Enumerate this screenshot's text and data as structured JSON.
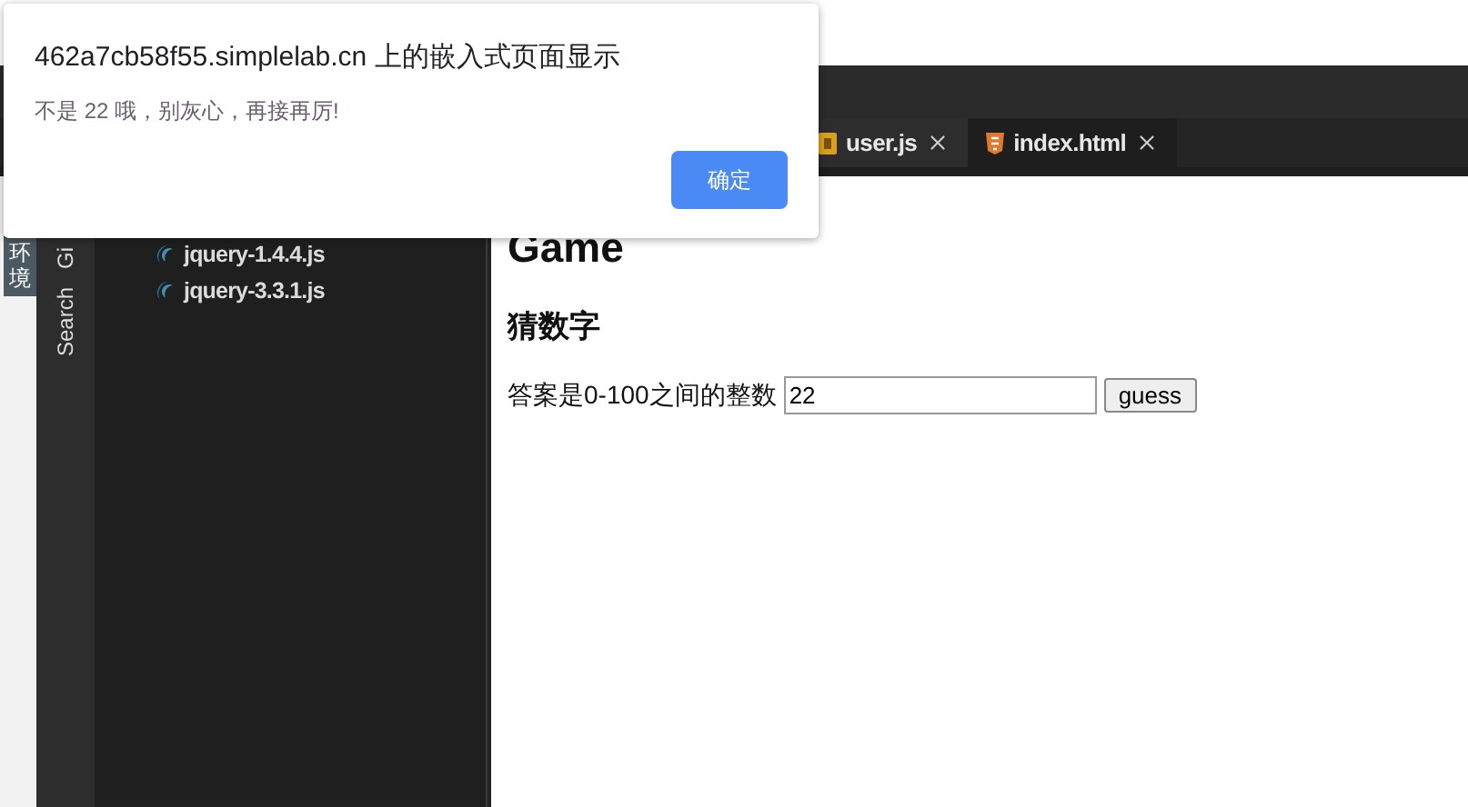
{
  "dialog": {
    "title": "462a7cb58f55.simplelab.cn 上的嵌入式页面显示",
    "message": "不是 22 哦，别灰心，再接再厉!",
    "button": "确定"
  },
  "editor_tabs": [
    {
      "label": "user.js",
      "kind": "js",
      "selected": false
    },
    {
      "label": "index.html",
      "kind": "html",
      "selected": true
    }
  ],
  "env_badge": "环境",
  "activity_bar": [
    {
      "label": "Gi"
    },
    {
      "label": "Search"
    }
  ],
  "file_tree": [
    {
      "name": "jquery-1.4.4.js"
    },
    {
      "name": "jquery-3.3.1.js"
    }
  ],
  "page": {
    "heading": "Game",
    "subheading": "猜数字",
    "prompt": "答案是0-100之间的整数",
    "input_value": "22",
    "button": "guess"
  }
}
